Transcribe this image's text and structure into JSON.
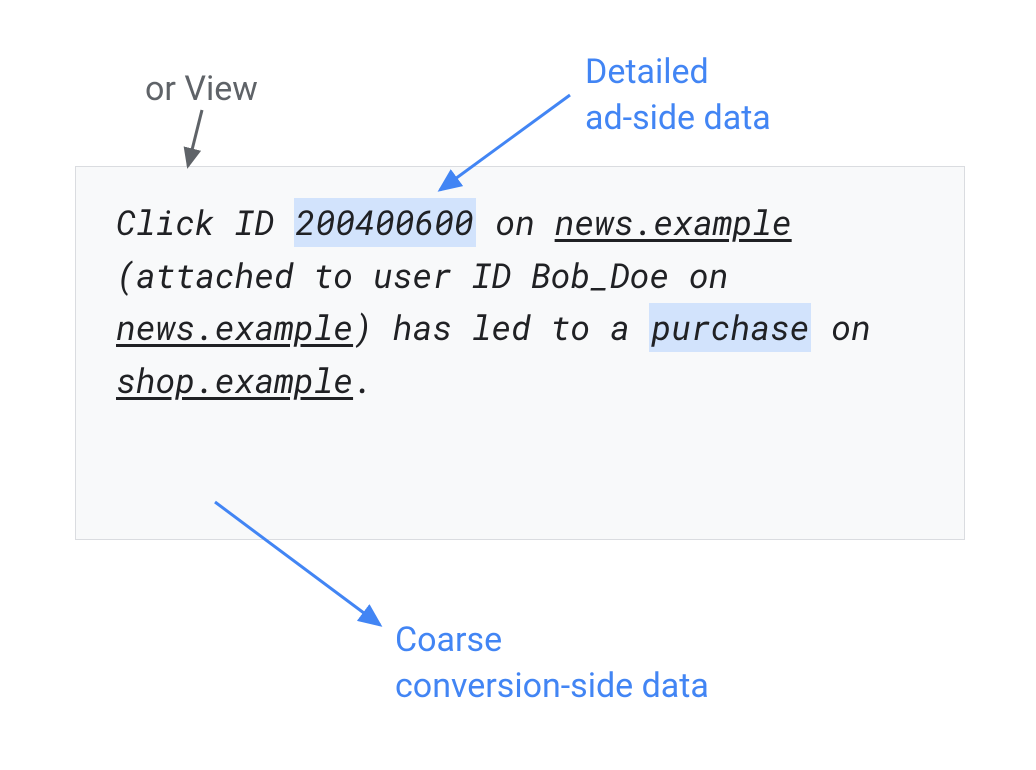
{
  "labels": {
    "orView": "or View",
    "detailedLine1": "Detailed",
    "detailedLine2": "ad-side data",
    "coarseLine1": "Coarse",
    "coarseLine2": "conversion-side data"
  },
  "boxText": {
    "part1": "Click ID ",
    "clickId": "200400600",
    "part2": " on ",
    "site1": "news.example",
    "part3": " (attached to user ID Bob_Doe on ",
    "site1b": "news.example",
    "part4": ") has led to a ",
    "purchase": "purchase",
    "part5": " on ",
    "site2": "shop.example",
    "part6": "."
  }
}
